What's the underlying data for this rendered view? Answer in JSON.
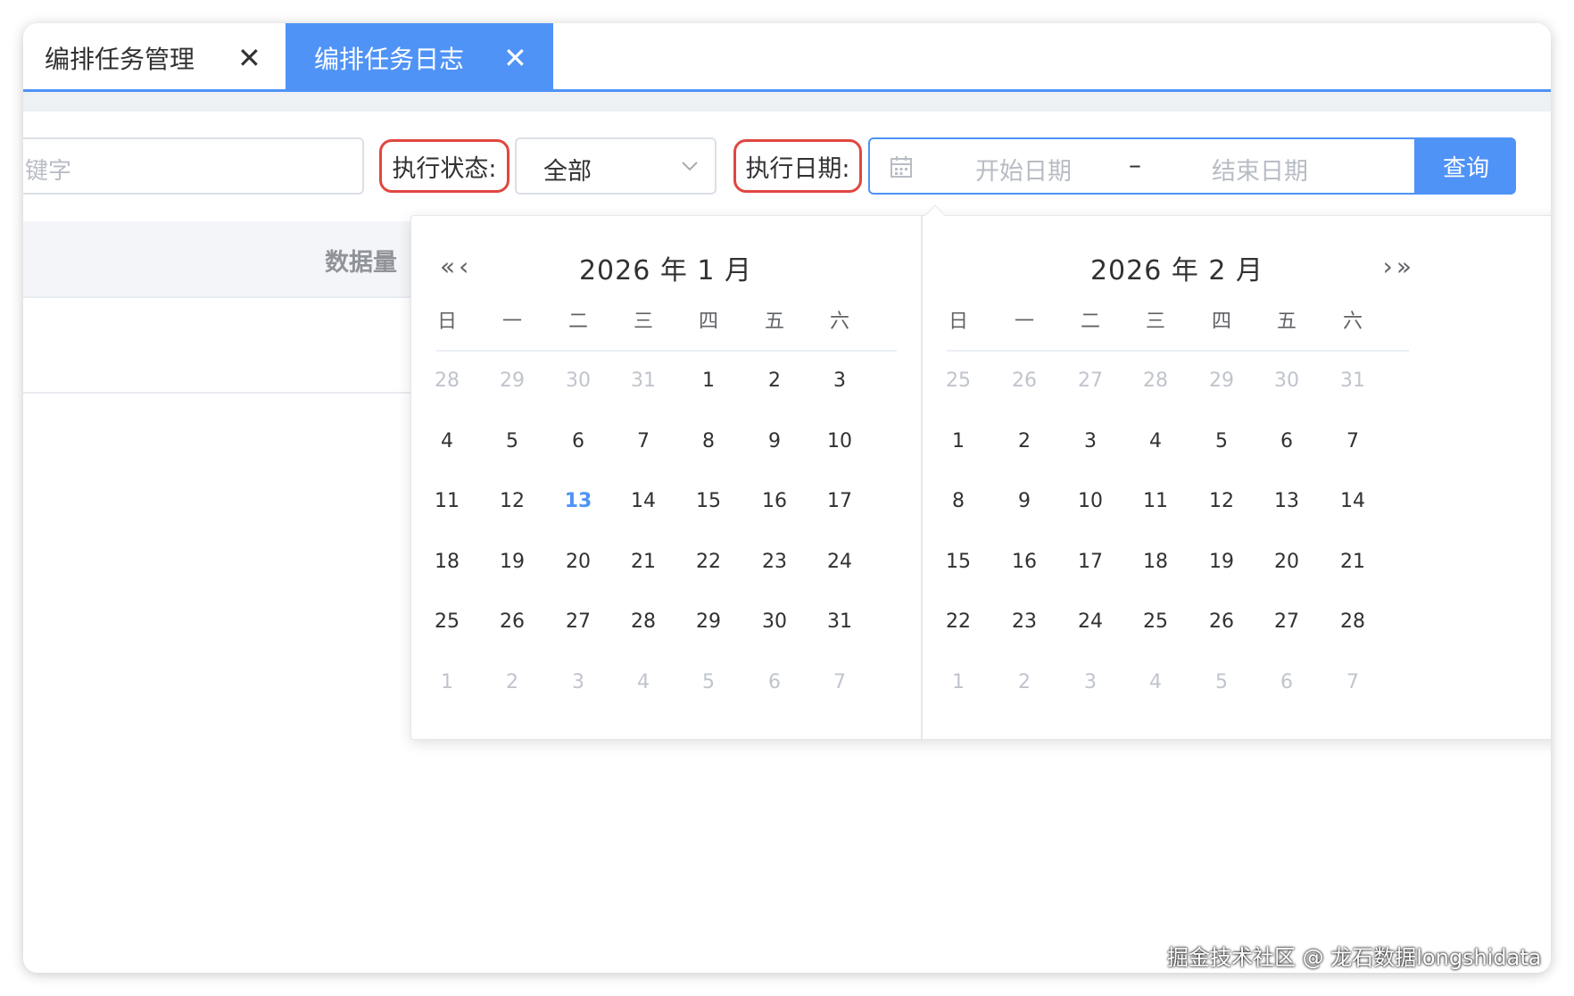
{
  "tabs": [
    {
      "label": "编排任务管理",
      "close": "✕"
    },
    {
      "label": "编排任务日志",
      "close": "✕"
    }
  ],
  "filters": {
    "keyword_placeholder": "键字",
    "status_label": "执行状态:",
    "status_value": "全部",
    "date_label": "执行日期:",
    "start_placeholder": "开始日期",
    "range_separator": "–",
    "end_placeholder": "结束日期",
    "query_button": "查询"
  },
  "table": {
    "column_data_volume": "数据量"
  },
  "calendar": {
    "left": {
      "title": "2026 年 1 月",
      "nav": "«‹",
      "weekdays": [
        "日",
        "一",
        "二",
        "三",
        "四",
        "五",
        "六"
      ],
      "days": [
        [
          "28",
          "29",
          "30",
          "31",
          "1",
          "2",
          "3"
        ],
        [
          "4",
          "5",
          "6",
          "7",
          "8",
          "9",
          "10"
        ],
        [
          "11",
          "12",
          "13",
          "14",
          "15",
          "16",
          "17"
        ],
        [
          "18",
          "19",
          "20",
          "21",
          "22",
          "23",
          "24"
        ],
        [
          "25",
          "26",
          "27",
          "28",
          "29",
          "30",
          "31"
        ],
        [
          "1",
          "2",
          "3",
          "4",
          "5",
          "6",
          "7"
        ]
      ],
      "muted": [
        [
          0,
          0
        ],
        [
          0,
          1
        ],
        [
          0,
          2
        ],
        [
          0,
          3
        ],
        [
          5,
          0
        ],
        [
          5,
          1
        ],
        [
          5,
          2
        ],
        [
          5,
          3
        ],
        [
          5,
          4
        ],
        [
          5,
          5
        ],
        [
          5,
          6
        ]
      ],
      "today": [
        2,
        2
      ]
    },
    "right": {
      "title": "2026 年 2 月",
      "nav": "›»",
      "weekdays": [
        "日",
        "一",
        "二",
        "三",
        "四",
        "五",
        "六"
      ],
      "days": [
        [
          "25",
          "26",
          "27",
          "28",
          "29",
          "30",
          "31"
        ],
        [
          "1",
          "2",
          "3",
          "4",
          "5",
          "6",
          "7"
        ],
        [
          "8",
          "9",
          "10",
          "11",
          "12",
          "13",
          "14"
        ],
        [
          "15",
          "16",
          "17",
          "18",
          "19",
          "20",
          "21"
        ],
        [
          "22",
          "23",
          "24",
          "25",
          "26",
          "27",
          "28"
        ],
        [
          "1",
          "2",
          "3",
          "4",
          "5",
          "6",
          "7"
        ]
      ],
      "muted": [
        [
          0,
          0
        ],
        [
          0,
          1
        ],
        [
          0,
          2
        ],
        [
          0,
          3
        ],
        [
          0,
          4
        ],
        [
          0,
          5
        ],
        [
          0,
          6
        ],
        [
          5,
          0
        ],
        [
          5,
          1
        ],
        [
          5,
          2
        ],
        [
          5,
          3
        ],
        [
          5,
          4
        ],
        [
          5,
          5
        ],
        [
          5,
          6
        ]
      ],
      "today": null
    },
    "accent_color": "#4f93f7"
  },
  "watermark": "掘金技术社区 @ 龙石数据longshidata",
  "colors": {
    "accent": "#4f93f7",
    "highlight_border": "#e0473f"
  }
}
